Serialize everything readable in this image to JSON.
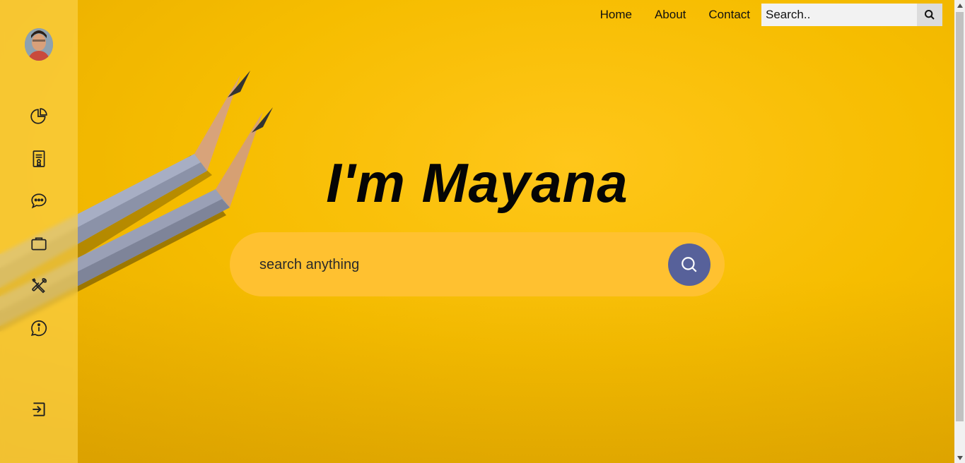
{
  "nav": {
    "home": "Home",
    "about": "About",
    "contact": "Contact",
    "search_placeholder": "Search..",
    "search_icon": "search-icon"
  },
  "hero": {
    "title": "I'm Mayana",
    "search_placeholder": "search anything",
    "search_icon": "search-icon"
  },
  "sidebar": {
    "avatar": "avatar",
    "items": [
      {
        "icon": "pie-chart-icon"
      },
      {
        "icon": "certificate-document-icon"
      },
      {
        "icon": "chat-bubble-icon"
      },
      {
        "icon": "briefcase-icon"
      },
      {
        "icon": "tools-icon"
      },
      {
        "icon": "info-chat-icon"
      }
    ],
    "logout_icon": "logout-icon"
  },
  "colors": {
    "background": "#f6bd00",
    "hero_search_bg": "#ffc130",
    "hero_button": "#57619a",
    "text": "#050505"
  }
}
